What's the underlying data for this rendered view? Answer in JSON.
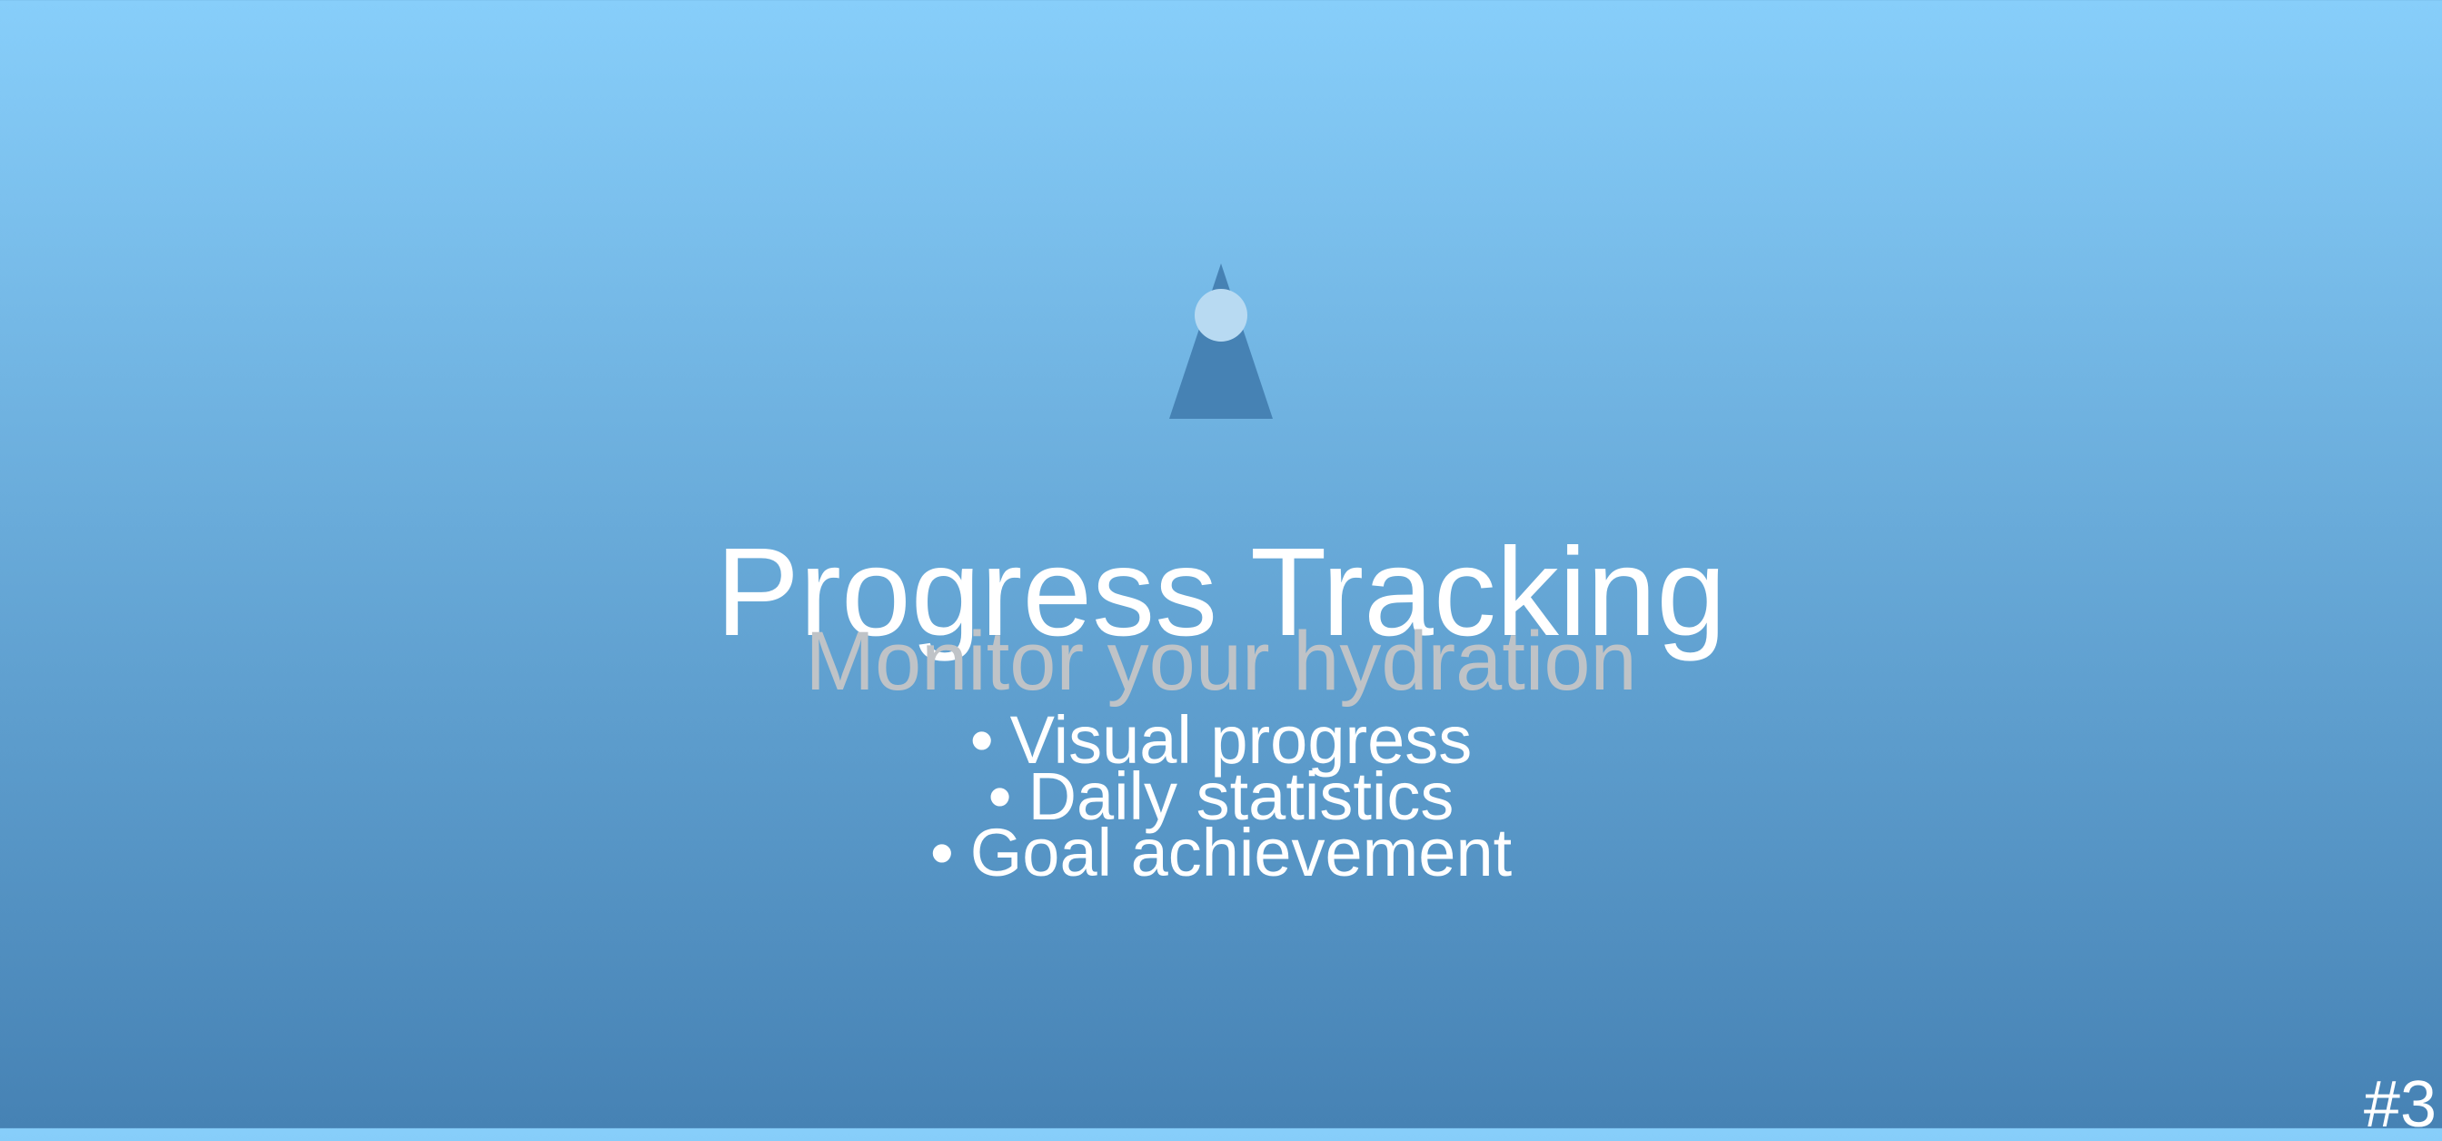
{
  "slide": {
    "title": "Progress Tracking",
    "subtitle": "Monitor your hydration",
    "bullet_marker": "•",
    "bullets": [
      "Visual progress",
      "Daily statistics",
      "Goal achievement"
    ],
    "slide_number": "#3"
  },
  "colors": {
    "background_top": "#87cefa",
    "background_bottom": "#4682b4",
    "logo_triangle": "#4682b4",
    "logo_dot": "#b8daf2",
    "subtitle_text": "#bfc3c7"
  },
  "icons": {
    "logo": "water-drop-icon"
  }
}
